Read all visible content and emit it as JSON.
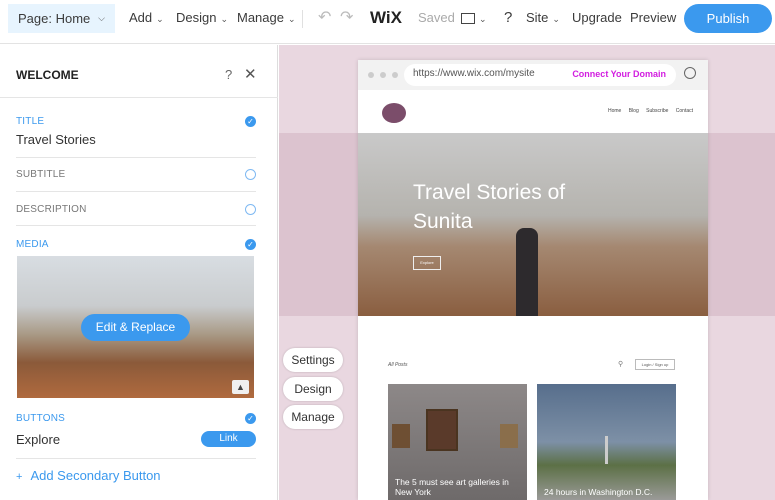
{
  "topbar": {
    "page": "Page: Home",
    "add": "Add",
    "design": "Design",
    "manage": "Manage",
    "logo": "WiX",
    "saved": "Saved",
    "help": "?",
    "site": "Site",
    "upgrade": "Upgrade",
    "preview": "Preview",
    "publish": "Publish"
  },
  "panel": {
    "title": "WELCOME",
    "help": "?",
    "sections": {
      "title_label": "TITLE",
      "title_value": "Travel Stories",
      "subtitle_label": "SUBTITLE",
      "description_label": "DESCRIPTION",
      "media_label": "MEDIA",
      "edit_replace": "Edit & Replace",
      "buttons_label": "BUTTONS",
      "button_value": "Explore",
      "link": "Link",
      "add_secondary": "Add Secondary Button"
    }
  },
  "floating": {
    "settings": "Settings",
    "design": "Design",
    "manage": "Manage"
  },
  "browser": {
    "url": "https://www.wix.com/mysite",
    "connect": "Connect Your Domain"
  },
  "site": {
    "nav": [
      "Home",
      "Blog",
      "Subscribe",
      "Contact"
    ],
    "hero_title": "Travel Stories of Sunita",
    "hero_button": "Explore",
    "all_posts": "All Posts",
    "login": "Login / Sign up",
    "posts": [
      {
        "title": "The 5 must see art galleries in New York"
      },
      {
        "title": "24 hours in Washington D.C."
      }
    ]
  },
  "colors": {
    "accent": "#3b99ee",
    "connect": "#d21ee0",
    "canvas": "#e9d7e0"
  }
}
